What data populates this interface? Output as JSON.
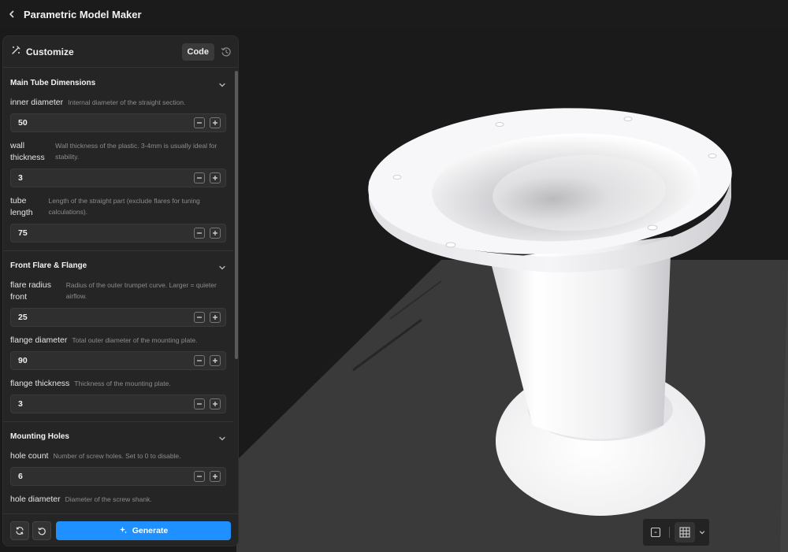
{
  "app": {
    "title": "Parametric Model Maker"
  },
  "panel": {
    "title": "Customize",
    "code_label": "Code",
    "sections": [
      {
        "title": "Main Tube Dimensions",
        "params": [
          {
            "label": "inner diameter",
            "desc": "Internal diameter of the straight section.",
            "value": "50"
          },
          {
            "label": "wall thickness",
            "desc": "Wall thickness of the plastic. 3-4mm is usually ideal for stability.",
            "value": "3"
          },
          {
            "label": "tube length",
            "desc": "Length of the straight part (exclude flares for tuning calculations).",
            "value": "75"
          }
        ]
      },
      {
        "title": "Front Flare & Flange",
        "params": [
          {
            "label": "flare radius front",
            "desc": "Radius of the outer trumpet curve. Larger = quieter airflow.",
            "value": "25"
          },
          {
            "label": "flange diameter",
            "desc": "Total outer diameter of the mounting plate.",
            "value": "90"
          },
          {
            "label": "flange thickness",
            "desc": "Thickness of the mounting plate.",
            "value": "3"
          }
        ]
      },
      {
        "title": "Mounting Holes",
        "params": [
          {
            "label": "hole count",
            "desc": "Number of screw holes. Set to 0 to disable.",
            "value": "6"
          },
          {
            "label": "hole diameter",
            "desc": "Diameter of the screw shank.",
            "value": ""
          }
        ]
      }
    ],
    "generate_label": "Generate"
  },
  "icons": {
    "back": "chevron-left-icon",
    "customize": "wand-icon",
    "history": "history-icon",
    "section_toggle": "chevron-down-icon",
    "minus": "minus-icon",
    "plus": "plus-icon",
    "refresh": "refresh-icon",
    "undo": "undo-icon",
    "sparkle": "sparkle-icon",
    "view_box": "square-view-icon",
    "grid": "grid-icon",
    "dropdown": "chevron-down-icon"
  },
  "colors": {
    "accent": "#1e90ff",
    "panel": "#252526",
    "background": "#1c1c1c",
    "model": "#f2f2f4"
  }
}
